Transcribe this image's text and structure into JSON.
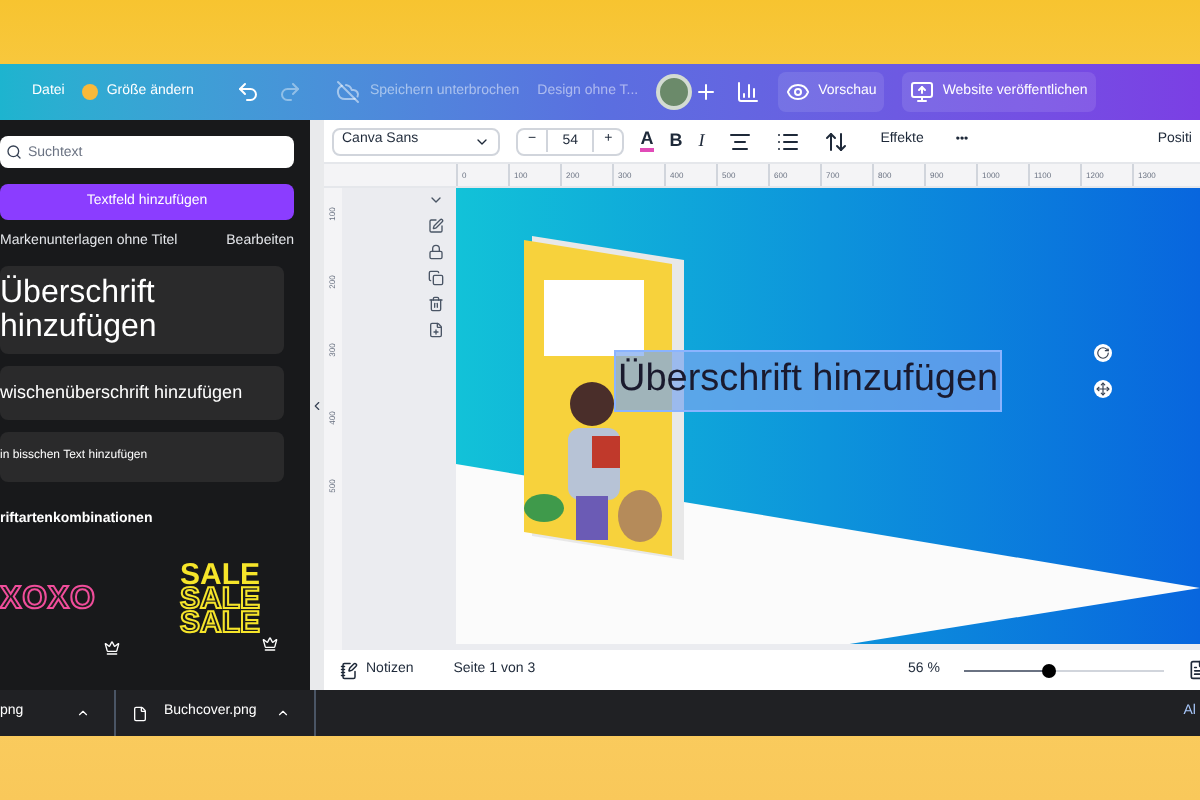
{
  "topbar": {
    "menu": "Datei",
    "resize": "Größe ändern",
    "redo_disabled": true,
    "save_status": "Speichern unterbrochen",
    "title": "Design ohne T...",
    "preview": "Vorschau",
    "publish": "Website veröffentlichen"
  },
  "sidebar": {
    "search": {
      "placeholder": "Suchtext"
    },
    "add_button": "Textfeld hinzufügen",
    "brand_kit": "Markenunterlagen ohne Titel",
    "edit": "Bearbeiten",
    "presets": [
      {
        "kind": "heading",
        "text": "Überschrift hinzufügen"
      },
      {
        "kind": "subheading",
        "text": "wischenüberschrift hinzufügen"
      },
      {
        "kind": "body",
        "text": "in bisschen Text hinzufügen"
      }
    ],
    "combos_title": "riftartenkombinationen",
    "combos": [
      {
        "kind": "xoxo",
        "lines": [
          "XOXO"
        ]
      },
      {
        "kind": "sale",
        "lines": [
          "SALE",
          "SALE",
          "SALE"
        ]
      }
    ]
  },
  "toolbar": {
    "font": "Canva Sans",
    "minus": "−",
    "size": "54",
    "plus": "+",
    "color_letter": "A",
    "bold": "B",
    "italic": "I",
    "effects": "Effekte",
    "more": "•••",
    "position": "Positi"
  },
  "ruler": {
    "horizontal": [
      "0",
      "100",
      "200",
      "300",
      "400",
      "500",
      "600",
      "700",
      "800",
      "900",
      "1000",
      "1100",
      "1200",
      "1300"
    ],
    "vertical": [
      "100",
      "200",
      "300",
      "400",
      "500"
    ]
  },
  "canvas": {
    "text_box": {
      "text": "Überschrift hinzufügen",
      "selected": true
    }
  },
  "bottombar": {
    "notes": "Notizen",
    "page": "Seite 1 von 3",
    "zoom": "56 %",
    "zoom_slider": {
      "level": 0.42
    }
  },
  "downloads": [
    {
      "name": "png"
    },
    {
      "name": "Buchcover.png"
    }
  ],
  "downloads_more": "Al"
}
